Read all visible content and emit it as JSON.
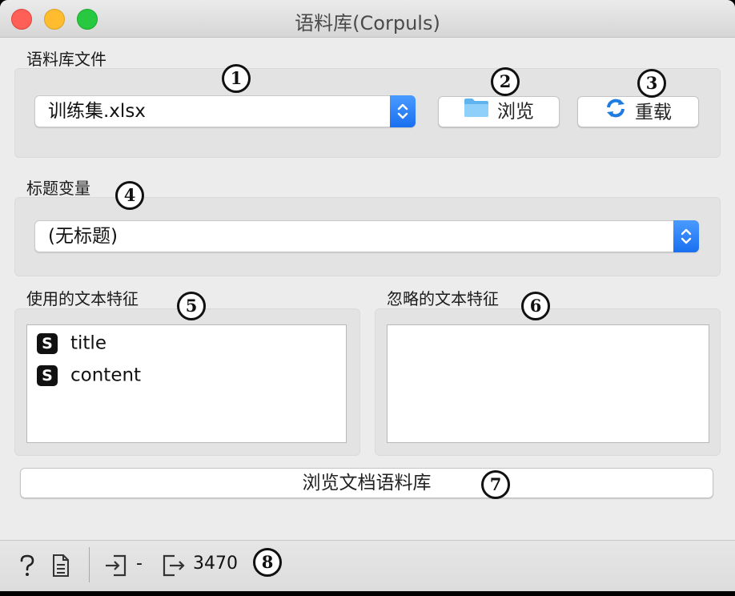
{
  "window": {
    "title": "语料库(Corpuls)"
  },
  "corpus_file": {
    "section_label": "语料库文件",
    "selected_file": "训练集.xlsx",
    "browse_label": "浏览",
    "reload_label": "重载"
  },
  "title_variable": {
    "section_label": "标题变量",
    "selected": "(无标题)"
  },
  "used_features": {
    "section_label": "使用的文本特征",
    "items": [
      {
        "badge": "S",
        "label": "title"
      },
      {
        "badge": "S",
        "label": "content"
      }
    ]
  },
  "ignored_features": {
    "section_label": "忽略的文本特征",
    "items": []
  },
  "browse_corpus_button": "浏览文档语料库",
  "annotations": [
    "1",
    "2",
    "3",
    "4",
    "5",
    "6",
    "7",
    "8"
  ],
  "status_bar": {
    "input_value": "-",
    "output_value": "3470",
    "icons": [
      "help-icon",
      "report-icon",
      "input-icon",
      "output-icon"
    ]
  },
  "colors": {
    "accent_blue": "#1a6ff0",
    "close": "#fe5f57",
    "minimize": "#febc2e",
    "maximize": "#28c840"
  }
}
